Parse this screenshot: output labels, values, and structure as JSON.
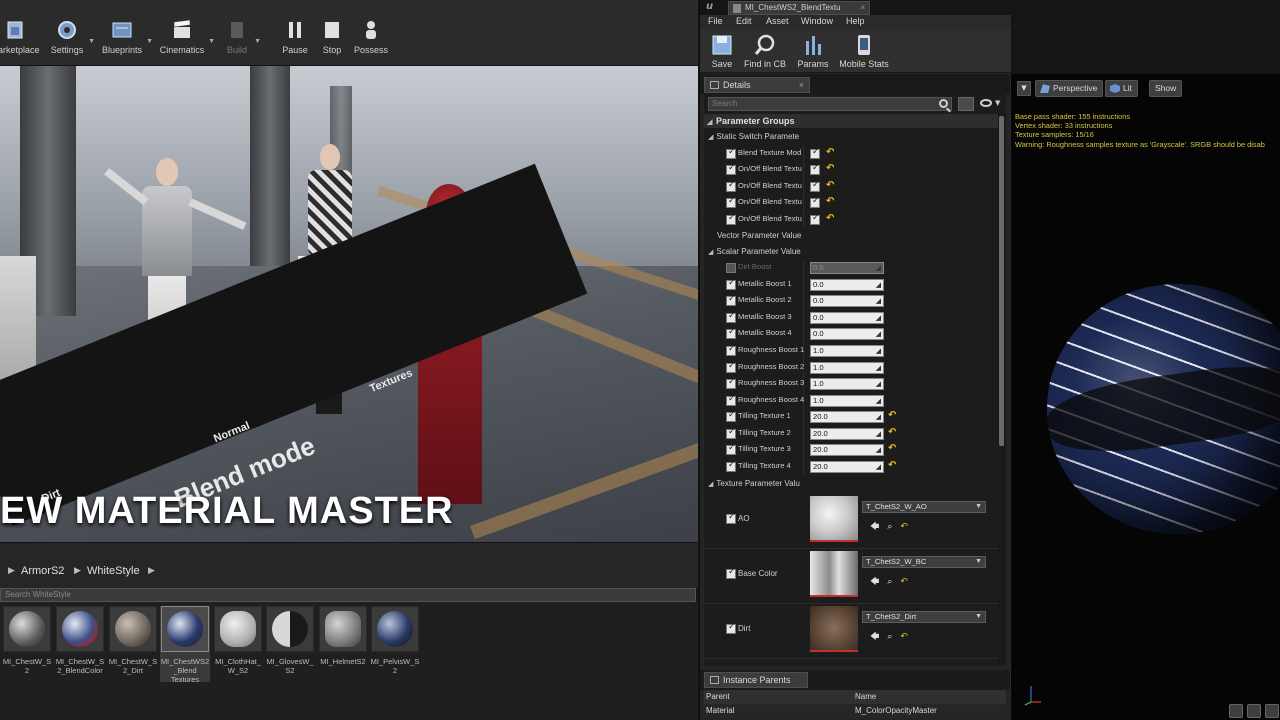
{
  "main_toolbar": {
    "buttons": [
      {
        "label": "Marketplace",
        "icon": "marketplace-icon"
      },
      {
        "label": "Settings",
        "icon": "gear-icon"
      },
      {
        "label": "Blueprints",
        "icon": "blueprint-icon"
      },
      {
        "label": "Cinematics",
        "icon": "clapper-icon"
      },
      {
        "label": "Build",
        "icon": "build-icon"
      },
      {
        "label": "Pause",
        "icon": "pause-icon"
      },
      {
        "label": "Stop",
        "icon": "stop-icon"
      },
      {
        "label": "Possess",
        "icon": "possess-icon"
      }
    ]
  },
  "viewport": {
    "floor_labels": [
      "Textures",
      "Normal",
      "Blend mode",
      "Dirt"
    ],
    "overlay_title": "EW MATERIAL MASTER"
  },
  "content_browser": {
    "breadcrumb": [
      "ArmorS2",
      "WhiteStyle"
    ],
    "search_placeholder": "Search WhiteStyle",
    "assets": [
      {
        "name": "MI_ChestW_S2"
      },
      {
        "name": "MI_ChestW_S2_BlendColor"
      },
      {
        "name": "MI_ChestW_S2_Dirt"
      },
      {
        "name": "MI_ChestWS2_Blend Textures",
        "selected": true
      },
      {
        "name": "MI_ClothHat_W_S2"
      },
      {
        "name": "MI_GlovesW_S2"
      },
      {
        "name": "MI_HelmetS2"
      },
      {
        "name": "MI_PelvisW_S2"
      }
    ]
  },
  "mi_editor": {
    "logo": "u",
    "tab_title": "MI_ChestWS2_BlendTextu",
    "menu": [
      "File",
      "Edit",
      "Asset",
      "Window",
      "Help"
    ],
    "toolbar": [
      {
        "label": "Save",
        "icon": "save-icon"
      },
      {
        "label": "Find in CB",
        "icon": "find-in-cb-icon"
      },
      {
        "label": "Params",
        "icon": "params-icon"
      },
      {
        "label": "Mobile Stats",
        "icon": "mobile-stats-icon"
      }
    ],
    "details": {
      "tab_label": "Details",
      "search_placeholder": "Search",
      "section_title": "Parameter Groups",
      "static_switch": {
        "title": "Static Switch Paramete",
        "rows": [
          {
            "name": "Blend Texture Mod",
            "checked": true
          },
          {
            "name": "On/Off Blend Textu",
            "checked": true
          },
          {
            "name": "On/Off Blend Textu",
            "checked": true
          },
          {
            "name": "On/Off Blend Textu",
            "checked": true
          },
          {
            "name": "On/Off Blend Textu",
            "checked": true
          }
        ]
      },
      "vector_title": "Vector Parameter Value",
      "scalar": {
        "title": "Scalar Parameter Value",
        "rows": [
          {
            "name": "Dirt Boost",
            "value": "0.0",
            "enabled": false
          },
          {
            "name": "Metallic Boost 1",
            "value": "0.0",
            "enabled": true
          },
          {
            "name": "Metallic Boost 2",
            "value": "0.0",
            "enabled": true
          },
          {
            "name": "Metallic Boost 3",
            "value": "0.0",
            "enabled": true
          },
          {
            "name": "Metallic Boost 4",
            "value": "0.0",
            "enabled": true
          },
          {
            "name": "Roughness Boost 1",
            "value": "1.0",
            "enabled": true
          },
          {
            "name": "Roughness Boost 2",
            "value": "1.0",
            "enabled": true
          },
          {
            "name": "Roughness Boost 3",
            "value": "1.0",
            "enabled": true
          },
          {
            "name": "Roughness Boost 4",
            "value": "1.0",
            "enabled": true
          },
          {
            "name": "Tilling Texture 1",
            "value": "20.0",
            "enabled": true
          },
          {
            "name": "Tilling Texture 2",
            "value": "20.0",
            "enabled": true
          },
          {
            "name": "Tilling Texture 3",
            "value": "20.0",
            "enabled": true
          },
          {
            "name": "Tilling Texture 4",
            "value": "20.0",
            "enabled": true
          }
        ]
      },
      "texture": {
        "title": "Texture Parameter Valu",
        "rows": [
          {
            "name": "AO",
            "texture": "T_ChetS2_W_AO"
          },
          {
            "name": "Base Color",
            "texture": "T_ChetS2_W_BC"
          },
          {
            "name": "Dirt",
            "texture": "T_ChetS2_Dirt"
          }
        ]
      }
    },
    "instance_parents": {
      "tab_label": "Instance Parents",
      "columns": [
        "Parent",
        "Name"
      ],
      "rows": [
        {
          "parent": "Material",
          "name": "M_ColorOpacityMaster"
        }
      ]
    }
  },
  "preview": {
    "buttons": [
      "Perspective",
      "Lit",
      "Show"
    ],
    "stats": [
      "Base pass shader: 155 instructions",
      "Vertex shader: 33 instructions",
      "Texture samplers: 15/16",
      "Warning: Roughness samples texture as 'Grayscale'. SRGB should be disab"
    ]
  },
  "colors": {
    "accent_yellow": "#e2c020",
    "stats_text": "#d7c640",
    "panel_bg": "#242424"
  }
}
